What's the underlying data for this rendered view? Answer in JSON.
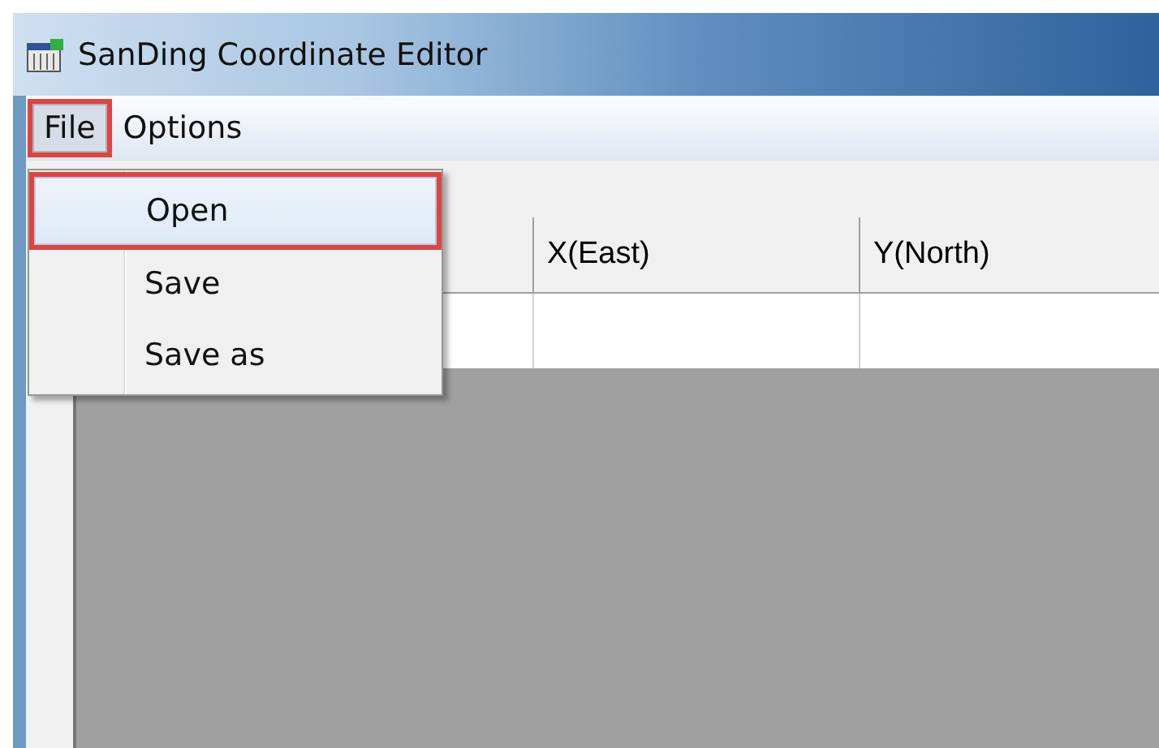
{
  "window": {
    "title": "SanDing Coordinate Editor"
  },
  "menu": [
    {
      "label": "File",
      "selected": true,
      "annotated": true
    },
    {
      "label": "Options",
      "selected": false,
      "annotated": false
    }
  ],
  "dropdown": [
    {
      "label": "Open",
      "selected": true,
      "annotated": true
    },
    {
      "label": "Save",
      "selected": false,
      "annotated": false
    },
    {
      "label": "Save as",
      "selected": false,
      "annotated": false
    }
  ],
  "table": {
    "columns": [
      "X(East)",
      "Y(North)"
    ]
  }
}
